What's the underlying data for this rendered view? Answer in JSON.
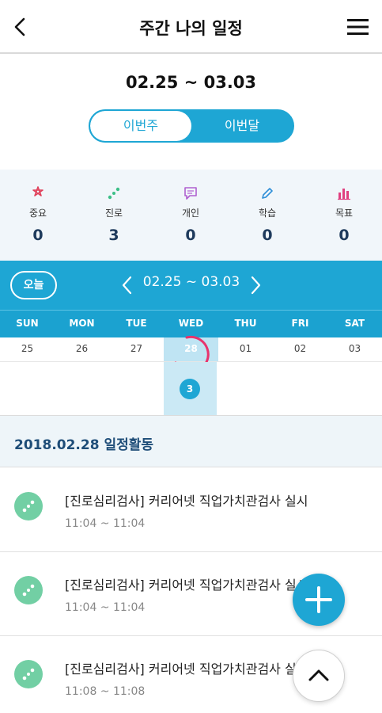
{
  "header": {
    "title": "주간 나의 일정",
    "back_icon": "chevron-left-icon",
    "menu_icon": "hamburger-menu-icon"
  },
  "range": {
    "title": "02.25 ~ 03.03"
  },
  "toggle": {
    "week_label": "이번주",
    "month_label": "이번달",
    "selected": "이번주"
  },
  "stats": [
    {
      "label": "중요",
      "count": "0",
      "icon": "star-icon",
      "color": "#e0405a"
    },
    {
      "label": "진로",
      "count": "3",
      "icon": "path-dots-icon",
      "color": "#3cbf87"
    },
    {
      "label": "개인",
      "count": "0",
      "icon": "speech-bubble-icon",
      "color": "#b060d0"
    },
    {
      "label": "학습",
      "count": "0",
      "icon": "pencil-icon",
      "color": "#2f8fd8"
    },
    {
      "label": "목표",
      "count": "0",
      "icon": "bar-chart-icon",
      "color": "#e04080"
    }
  ],
  "calendar": {
    "today_label": "오늘",
    "range": "02.25 ~ 03.03",
    "weekdays": [
      "SUN",
      "MON",
      "TUE",
      "WED",
      "THU",
      "FRI",
      "SAT"
    ],
    "dates": [
      "25",
      "26",
      "27",
      "28",
      "01",
      "02",
      "03"
    ],
    "selected_date": "28",
    "selected_count": "3",
    "accent": "#1ea6d4"
  },
  "activities": {
    "date_title": "2018.02.28 일정활동",
    "items": [
      {
        "title": "[진로심리검사] 커리어넷 직업가치관검사 실시",
        "time": "11:04 ~ 11:04"
      },
      {
        "title": "[진로심리검사] 커리어넷 직업가치관검사 실시",
        "time": "11:04 ~ 11:04"
      },
      {
        "title": "[진로심리검사] 커리어넷 직업가치관검사 실시",
        "time": "11:08 ~ 11:08"
      }
    ]
  },
  "fab": {
    "add_icon": "plus-icon",
    "top_icon": "chevron-up-icon"
  }
}
